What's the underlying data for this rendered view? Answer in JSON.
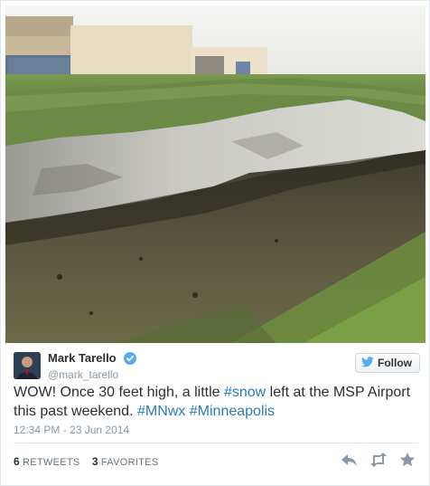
{
  "user": {
    "display_name": "Mark Tarello",
    "handle": "@mark_tarello",
    "verified": true
  },
  "follow_button": {
    "label": "Follow"
  },
  "tweet": {
    "text_parts": [
      {
        "text": "WOW! Once 30 feet high, a little ",
        "type": "text"
      },
      {
        "text": "#snow",
        "type": "hashtag"
      },
      {
        "text": " left at the MSP Airport this past weekend. ",
        "type": "text"
      },
      {
        "text": "#MNwx",
        "type": "hashtag"
      },
      {
        "text": " ",
        "type": "text"
      },
      {
        "text": "#Minneapolis",
        "type": "hashtag"
      }
    ],
    "timestamp": "12:34 PM - 23 Jun 2014"
  },
  "stats": {
    "retweets_count": "6",
    "retweets_label": "RETWEETS",
    "favorites_count": "3",
    "favorites_label": "FAVORITES"
  },
  "colors": {
    "link": "#2b7bb9",
    "verified": "#55acee",
    "muted": "#8899a6"
  },
  "icons": [
    "verified-badge-icon",
    "twitter-bird-icon",
    "reply-icon",
    "retweet-icon",
    "favorite-star-icon"
  ]
}
